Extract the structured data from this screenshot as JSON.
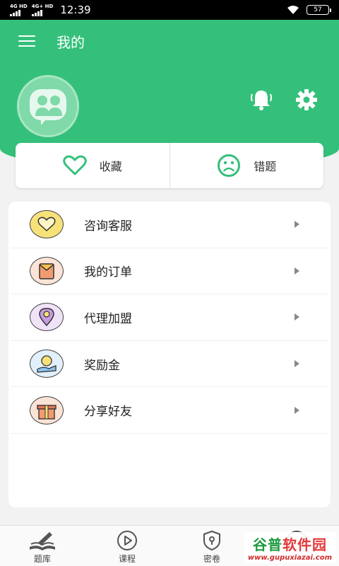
{
  "status_bar": {
    "network_1": "4G HD",
    "network_2": "4G+ HD",
    "time": "12:39",
    "battery": "57",
    "icons": [
      "signal-icon",
      "signal-icon",
      "wifi-icon",
      "battery-icon"
    ]
  },
  "header": {
    "title": "我的",
    "accent_color": "#34c07a",
    "icons": [
      "menu-icon",
      "avatar-icon",
      "bell-icon",
      "settings-icon"
    ]
  },
  "quick_actions": [
    {
      "label": "收藏",
      "icon": "heart-icon"
    },
    {
      "label": "错题",
      "icon": "sad-face-icon"
    }
  ],
  "menu": {
    "items": [
      {
        "label": "咨询客服",
        "icon": "heart-bubble-icon",
        "icon_color": "#f7e27a"
      },
      {
        "label": "我的订单",
        "icon": "order-envelope-icon",
        "icon_color": "#f29b6f"
      },
      {
        "label": "代理加盟",
        "icon": "location-pin-icon",
        "icon_color": "#c79be0"
      },
      {
        "label": "奖励金",
        "icon": "coin-hand-icon",
        "icon_color": "#8cc4ee"
      },
      {
        "label": "分享好友",
        "icon": "gift-box-icon",
        "icon_color": "#f29b6f"
      }
    ]
  },
  "tab_bar": {
    "tabs": [
      {
        "label": "题库",
        "icon": "book-pen-icon"
      },
      {
        "label": "课程",
        "icon": "play-circle-icon"
      },
      {
        "label": "密卷",
        "icon": "lock-shield-icon"
      },
      {
        "label": "",
        "icon": "profile-icon"
      }
    ]
  },
  "watermark": {
    "title_a": "谷普",
    "title_b": "软件园",
    "url": "www.gupuxiazai.com"
  }
}
